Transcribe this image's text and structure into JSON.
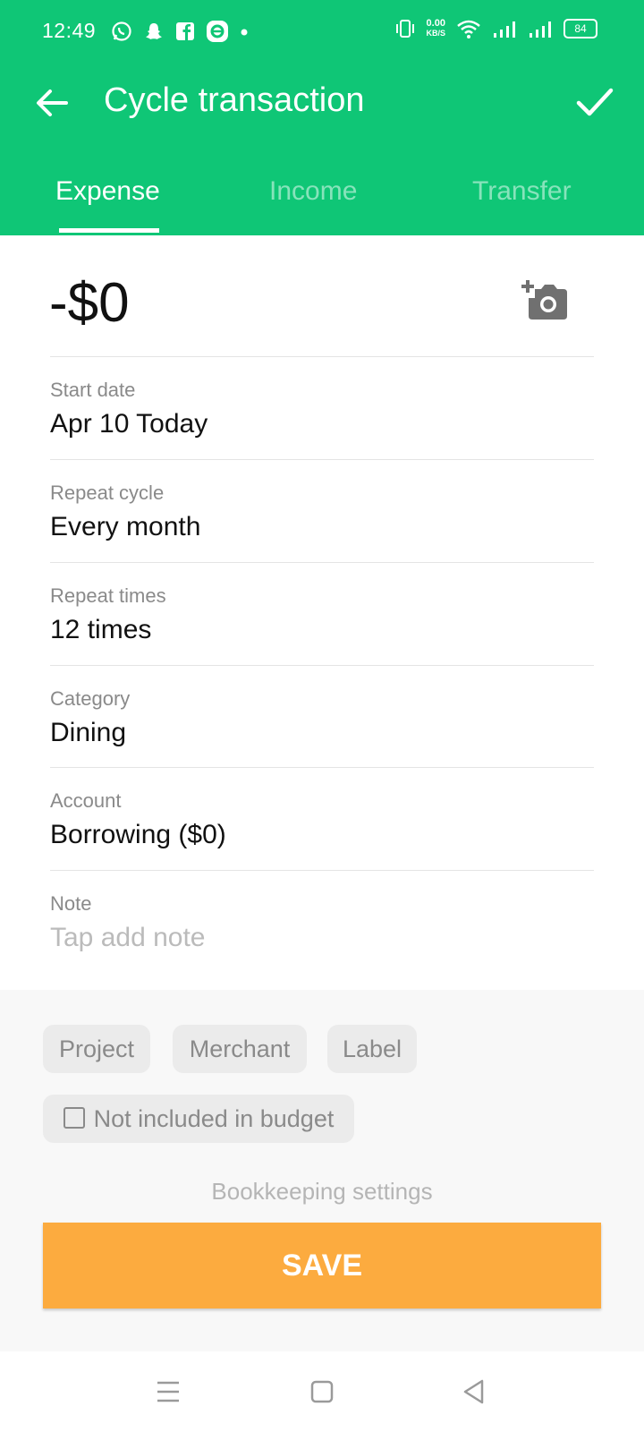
{
  "status_bar": {
    "time": "12:49",
    "net_speed_value": "0.00",
    "net_speed_unit": "KB/S",
    "battery": "84"
  },
  "header": {
    "title": "Cycle transaction",
    "tabs": [
      {
        "label": "Expense",
        "active": true
      },
      {
        "label": "Income",
        "active": false
      },
      {
        "label": "Transfer",
        "active": false
      }
    ]
  },
  "amount": "-$0",
  "fields": [
    {
      "label": "Start date",
      "value": "Apr 10  Today"
    },
    {
      "label": "Repeat cycle",
      "value": "Every month"
    },
    {
      "label": "Repeat times",
      "value": "12 times"
    },
    {
      "label": "Category",
      "value": "Dining"
    },
    {
      "label": "Account",
      "value": "Borrowing ($0)"
    },
    {
      "label": "Note",
      "placeholder": "Tap add note"
    }
  ],
  "chips": [
    "Project",
    "Merchant",
    "Label"
  ],
  "budget_checkbox": {
    "label": "Not included in budget",
    "checked": false
  },
  "settings_link": "Bookkeeping settings",
  "save_label": "SAVE",
  "colors": {
    "header": "#0fc676",
    "save_button": "#fcab3f",
    "background": "#f8f8f8"
  },
  "icons": [
    "whatsapp-icon",
    "snapchat-icon",
    "facebook-icon",
    "notification-icon",
    "vibrate-icon",
    "wifi-icon",
    "signal-icon",
    "battery-icon",
    "back-arrow-icon",
    "checkmark-icon",
    "add-photo-icon",
    "menu-icon",
    "home-icon",
    "back-icon"
  ]
}
